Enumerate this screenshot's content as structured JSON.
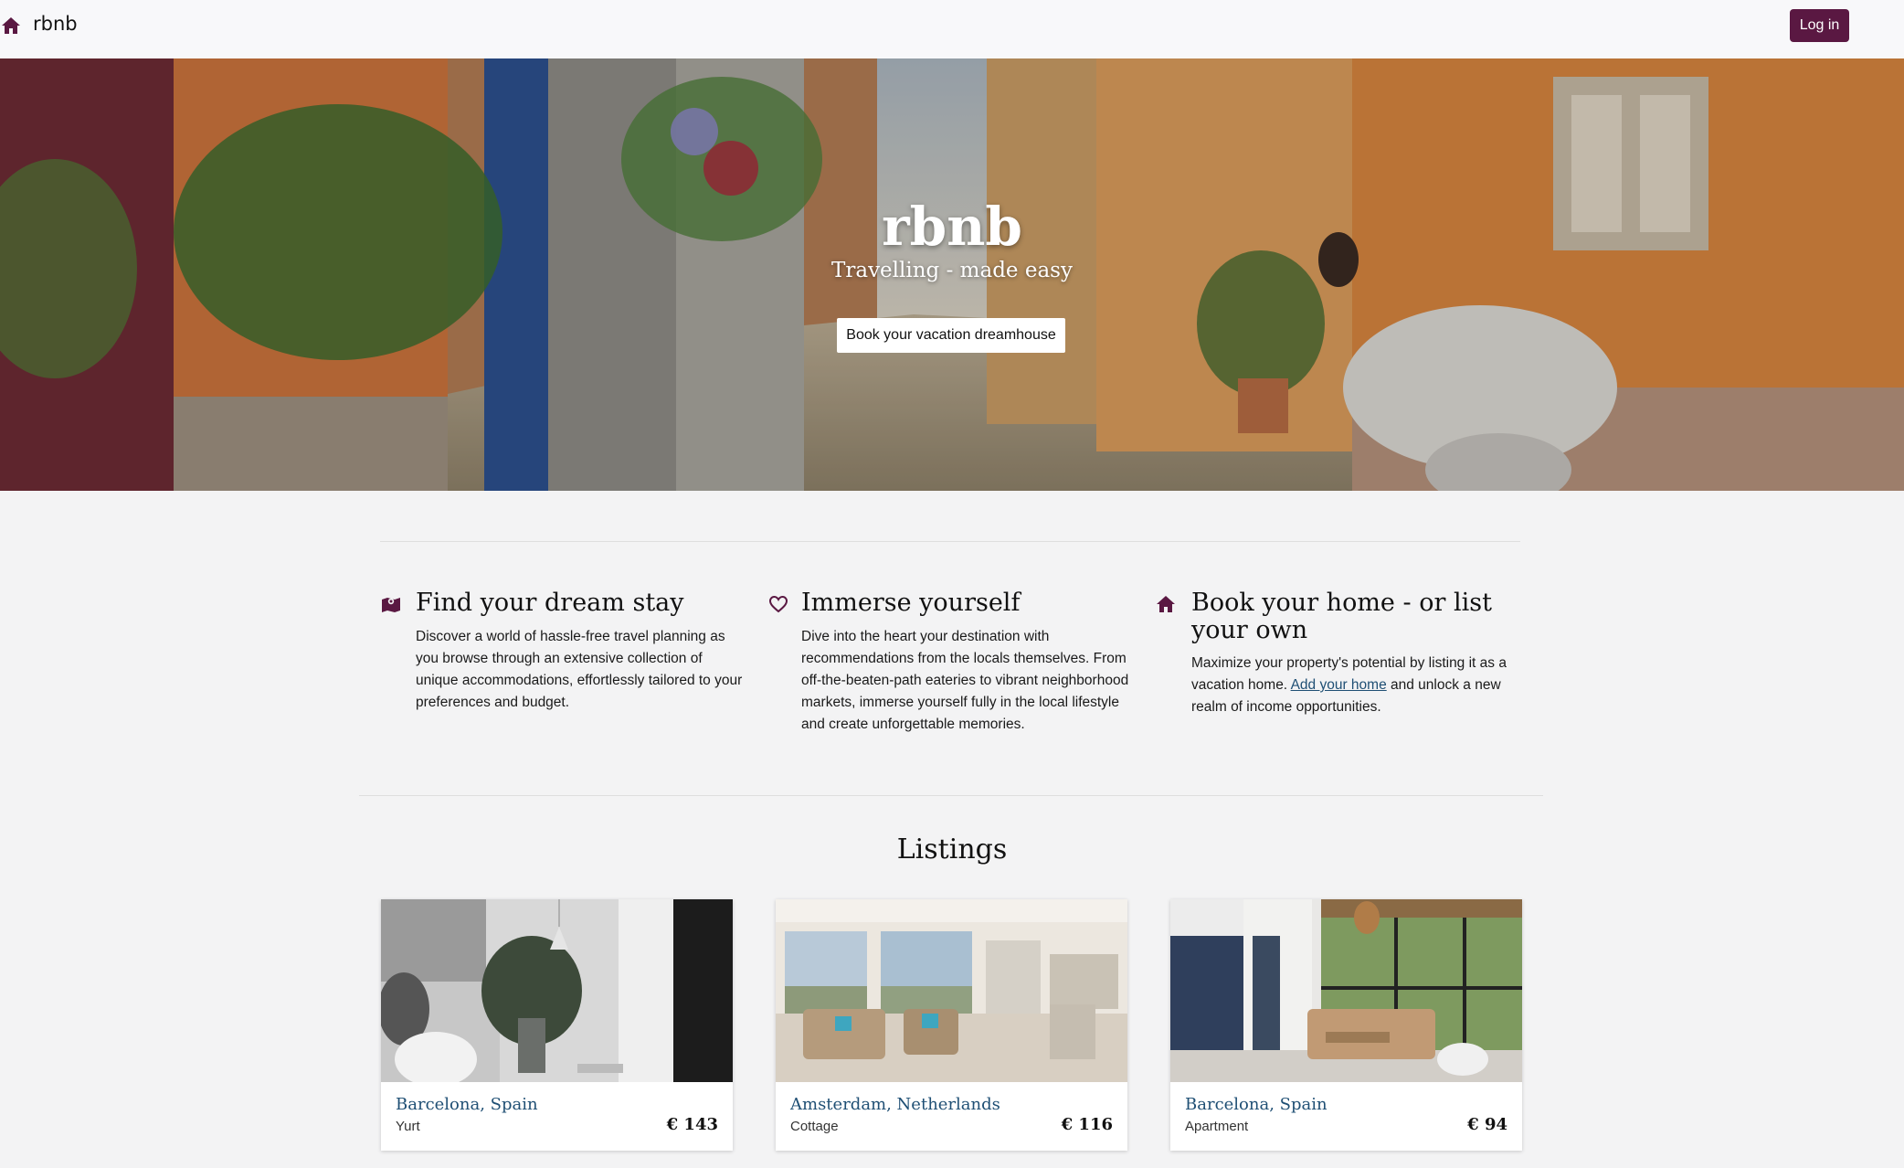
{
  "nav": {
    "brand": "rbnb",
    "login_label": "Log in",
    "home_icon": "home-icon"
  },
  "hero": {
    "title": "rbnb",
    "subtitle": "Travelling - made easy",
    "cta_label": "Book your vacation dreamhouse"
  },
  "features": [
    {
      "icon": "map-icon",
      "title": "Find your dream stay",
      "text": "Discover a world of hassle-free travel planning as you browse through an extensive collection of unique accommodations, effortlessly tailored to your preferences and budget."
    },
    {
      "icon": "heart-icon",
      "title": "Immerse yourself",
      "text": "Dive into the heart your destination with recommendations from the locals themselves. From off-the-beaten-path eateries to vibrant neighborhood markets, immerse yourself fully in the local lifestyle and create unforgettable memories."
    },
    {
      "icon": "home-icon",
      "title": "Book your home - or list your own",
      "text_before": "Maximize your property's potential by listing it as a vacation home.",
      "link": "Add your home",
      "text_after": "and unlock a new realm of income opportunities."
    }
  ],
  "listings": {
    "title": "Listings",
    "items": [
      {
        "city": "Barcelona, Spain",
        "type": "Yurt",
        "price": "€ 143"
      },
      {
        "city": "Amsterdam, Netherlands",
        "type": "Cottage",
        "price": "€ 116"
      },
      {
        "city": "Barcelona, Spain",
        "type": "Apartment",
        "price": "€ 94"
      }
    ]
  },
  "colors": {
    "brand": "#5a1842",
    "link": "#1f4f74",
    "background": "#f3f3f4"
  }
}
